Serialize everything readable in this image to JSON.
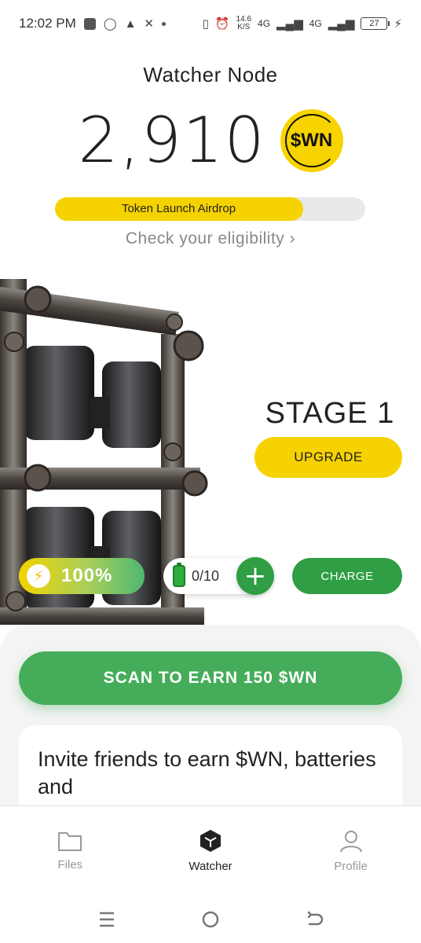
{
  "status_bar": {
    "time": "12:02 PM",
    "net_speed_value": "14.6",
    "net_speed_unit": "K/S",
    "signal_1": "4G",
    "signal_2": "4G",
    "battery_level": "27"
  },
  "header": {
    "title": "Watcher Node",
    "balance": "2,910",
    "token_symbol": "$WN"
  },
  "airdrop": {
    "label": "Token Launch Airdrop",
    "progress_percent": 80,
    "eligibility_link": "Check your eligibility ›"
  },
  "node": {
    "stage": "STAGE 1",
    "upgrade_label": "UPGRADE"
  },
  "energy": {
    "value": "100%",
    "icon": "lightning-bolt-icon"
  },
  "batteries": {
    "count": "0/10",
    "add_icon": "plus-icon",
    "charge_label": "CHARGE"
  },
  "actions": {
    "scan_label": "SCAN TO EARN 150 $WN"
  },
  "invite_card": {
    "text": "Invite friends to earn $WN, batteries and"
  },
  "bottom_nav": {
    "items": [
      {
        "label": "Files",
        "icon": "folder-icon"
      },
      {
        "label": "Watcher",
        "icon": "cube-icon"
      },
      {
        "label": "Profile",
        "icon": "person-icon"
      }
    ],
    "active": "Watcher"
  },
  "colors": {
    "accent_yellow": "#f6d200",
    "accent_green": "#2f9e44",
    "scan_green": "#45ad5a"
  }
}
